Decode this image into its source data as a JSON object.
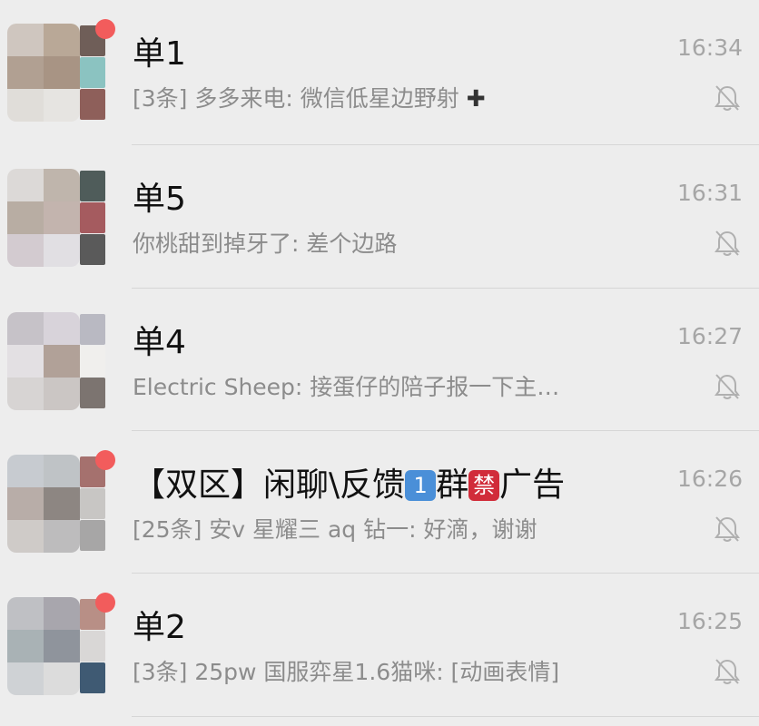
{
  "chats": [
    {
      "title": "单1",
      "preview_prefix": "[3条] 多多来电: 微信低星边野射",
      "preview_suffix": "✚",
      "time": "16:34",
      "unread": true,
      "muted": true
    },
    {
      "title": "单5",
      "preview_prefix": "你桃甜到掉牙了: 差个边路",
      "time": "16:31",
      "unread": false,
      "muted": true
    },
    {
      "title": "单4",
      "preview_prefix": "Electric Sheep: 接蛋仔的陪子报一下主…",
      "time": "16:27",
      "unread": false,
      "muted": true
    },
    {
      "title_part1": "【双区】闲聊\\反馈",
      "title_badge1": "1",
      "title_part2": "群",
      "title_badge2": "禁",
      "title_part3": "广告",
      "preview_prefix": "[25条] 安v  星耀三   aq 钻一: 好滴，谢谢",
      "time": "16:26",
      "unread": true,
      "muted": true
    },
    {
      "title": "单2",
      "preview_prefix": "[3条] 25pw 国服弈星1.6猫咪: [动画表情]",
      "time": "16:25",
      "unread": true,
      "muted": true
    }
  ],
  "colors": {
    "background": "#ededed",
    "unread_dot": "#f25c5c",
    "title": "#111111",
    "preview": "#8c8c8c",
    "time": "#a6a6a6"
  },
  "icons": {
    "mute": "bell-slash-icon",
    "unread": "red-dot"
  }
}
